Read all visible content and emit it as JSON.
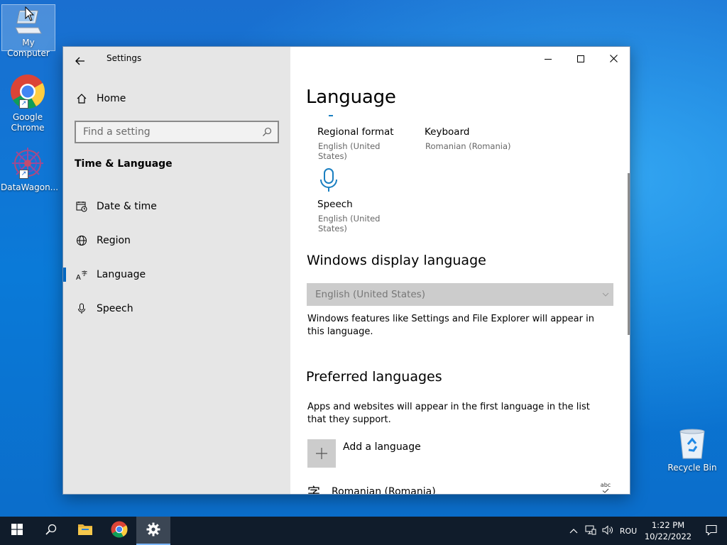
{
  "desktop": {
    "icons": [
      {
        "label": "My Computer"
      },
      {
        "label": "Google Chrome"
      },
      {
        "label": "DataWagon..."
      },
      {
        "label": "Recycle Bin"
      }
    ]
  },
  "window": {
    "app_title": "Settings",
    "nav": {
      "home": "Home",
      "search_placeholder": "Find a setting",
      "section_title": "Time & Language",
      "items": [
        {
          "label": "Date & time",
          "icon": "calendar-clock-icon"
        },
        {
          "label": "Region",
          "icon": "globe-icon"
        },
        {
          "label": "Language",
          "icon": "language-icon",
          "active": true
        },
        {
          "label": "Speech",
          "icon": "microphone-icon"
        }
      ]
    },
    "content": {
      "page_title": "Language",
      "tiles": [
        {
          "title": "Regional format",
          "subtitle": "English (United States)"
        },
        {
          "title": "Keyboard",
          "subtitle": "Romanian (Romania)"
        },
        {
          "title": "Speech",
          "subtitle": "English (United States)"
        }
      ],
      "display_language": {
        "heading": "Windows display language",
        "selected": "English (United States)",
        "description": "Windows features like Settings and File Explorer will appear in this language."
      },
      "preferred": {
        "heading": "Preferred languages",
        "description": "Apps and websites will appear in the first language in the list that they support.",
        "add_label": "Add a language",
        "languages": [
          {
            "name": "Romanian (Romania)",
            "glyph": "字"
          }
        ],
        "spell_badge": "abc"
      }
    }
  },
  "taskbar": {
    "tray_language": "ROU",
    "time": "1:22 PM",
    "date": "10/22/2022"
  },
  "colors": {
    "accent": "#0067c0",
    "mic_icon": "#1a7fc1",
    "taskbar": "#101c2b"
  }
}
